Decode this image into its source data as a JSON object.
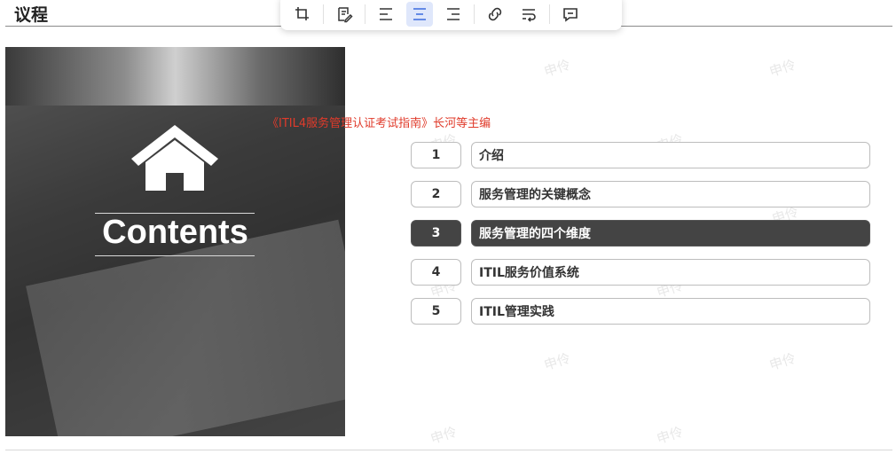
{
  "slide": {
    "title": "议程"
  },
  "toolbar": {
    "buttons": [
      {
        "icon": "crop-icon"
      },
      {
        "icon": "edit-note-icon"
      },
      {
        "icon": "align-left-icon"
      },
      {
        "icon": "align-center-icon",
        "active": true
      },
      {
        "icon": "align-right-icon"
      },
      {
        "icon": "link-icon"
      },
      {
        "icon": "text-wrap-icon"
      },
      {
        "icon": "comment-icon"
      }
    ]
  },
  "cover": {
    "heading": "Contents",
    "icon": "home-icon"
  },
  "source_note": "《ITIL4服务管理认证考试指南》长河等主编",
  "agenda": {
    "items": [
      {
        "number": "1",
        "label": "介绍"
      },
      {
        "number": "2",
        "label": "服务管理的关键概念"
      },
      {
        "number": "3",
        "label": "服务管理的四个维度",
        "active": true
      },
      {
        "number": "4",
        "label": "ITIL服务价值系统"
      },
      {
        "number": "5",
        "label": "ITIL管理实践"
      }
    ]
  },
  "watermark": "申伶",
  "colors": {
    "accent": "#dfe7fb",
    "active_row": "#444444",
    "note": "#e03b2b"
  }
}
